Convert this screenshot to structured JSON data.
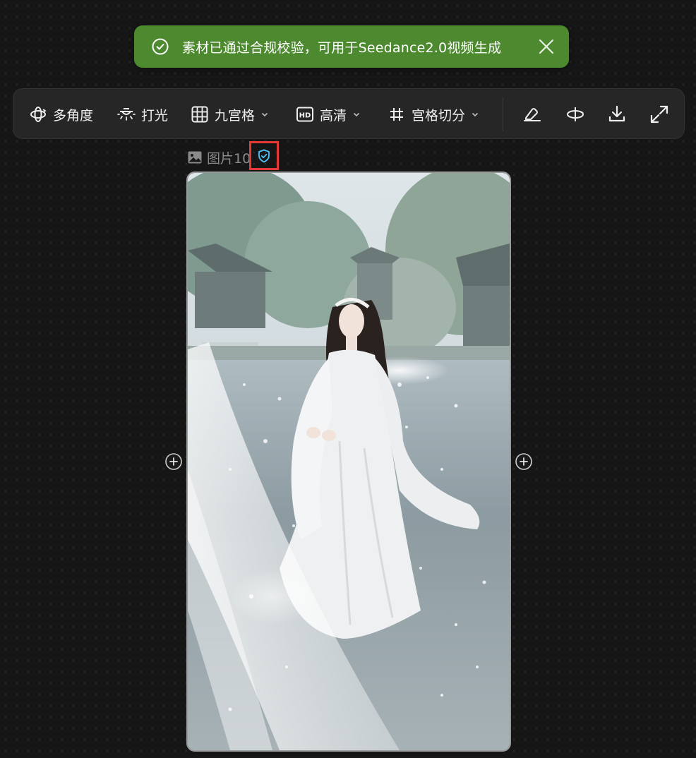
{
  "toast": {
    "message": "素材已通过合规校验，可用于Seedance2.0视频生成",
    "icon": "check-circle-icon",
    "close_icon": "close-icon",
    "background": "#4d8a2f"
  },
  "toolbar": {
    "items": [
      {
        "label": "多角度",
        "icon": "multi-angle-icon"
      },
      {
        "label": "打光",
        "icon": "lighting-icon"
      },
      {
        "label": "九宫格",
        "icon": "grid-icon"
      },
      {
        "label": "高清",
        "icon": "hd-icon"
      },
      {
        "label": "宫格切分",
        "icon": "hash-icon"
      }
    ],
    "actions": [
      {
        "name": "eraser",
        "icon": "eraser-icon"
      },
      {
        "name": "flip",
        "icon": "flip-icon"
      },
      {
        "name": "download",
        "icon": "download-icon"
      },
      {
        "name": "fullscreen",
        "icon": "expand-icon"
      }
    ]
  },
  "node": {
    "label": "图片10",
    "icon": "image-icon",
    "badge_icon": "shield-check-icon",
    "highlight_color": "#e53935"
  },
  "image": {
    "description_icon": "photo"
  }
}
